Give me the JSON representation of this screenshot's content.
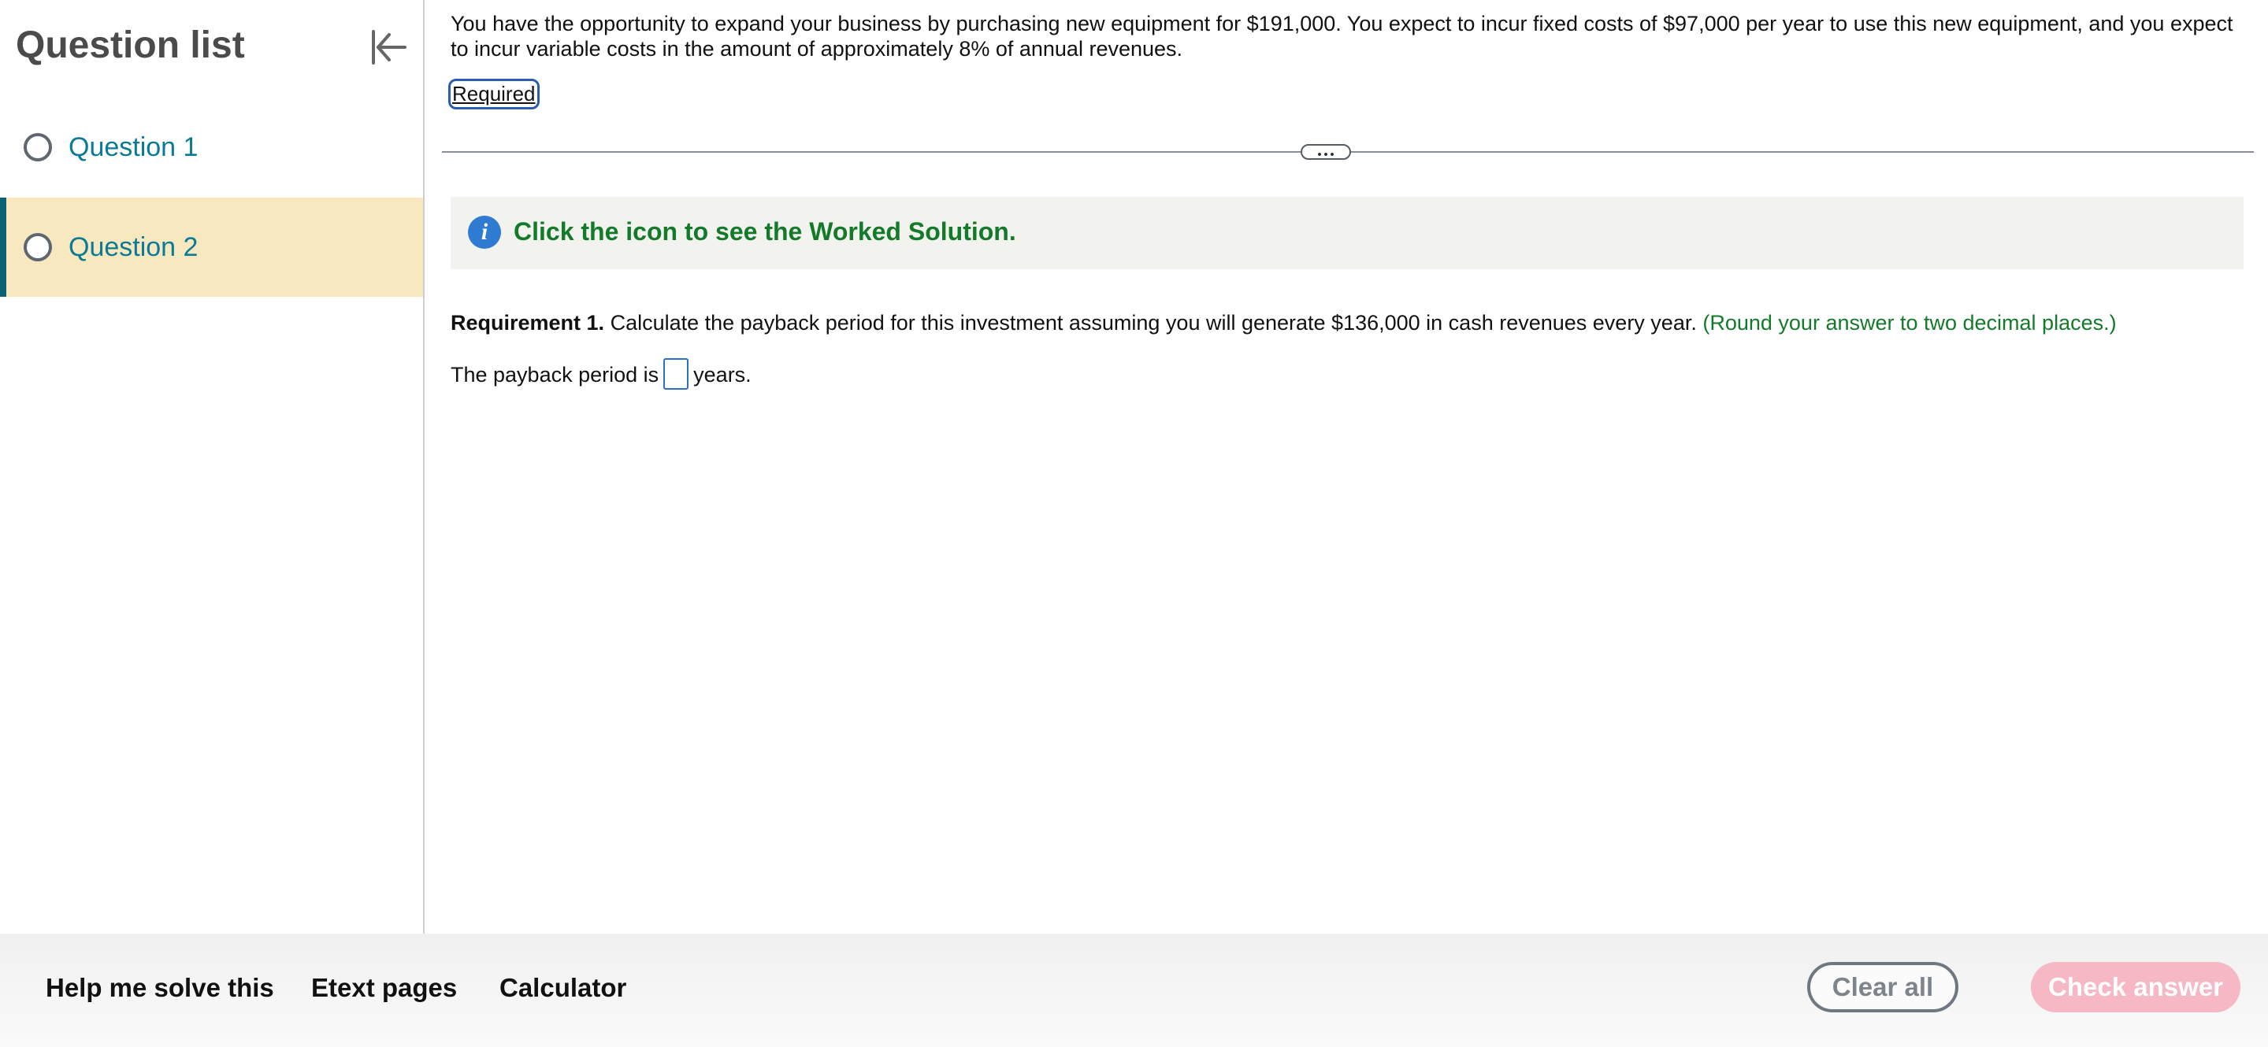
{
  "sidebar": {
    "title": "Question list",
    "items": [
      {
        "label": "Question 1",
        "active": false
      },
      {
        "label": "Question 2",
        "active": true
      }
    ]
  },
  "problem": {
    "text": "You have the opportunity to expand your business by purchasing new equipment for $191,000. You expect to incur fixed costs of $97,000 per year to use this new equipment, and you expect to incur variable costs in the amount of approximately 8% of annual revenues.",
    "required_link": "Required"
  },
  "info": {
    "text": "Click the icon to see the Worked Solution."
  },
  "requirement": {
    "label": "Requirement 1.",
    "text": " Calculate the payback period for this investment assuming you will generate $136,000 in cash revenues every year. ",
    "hint": "(Round your answer to two decimal places.)"
  },
  "answer": {
    "prefix": "The payback period is",
    "value": "",
    "suffix": "years."
  },
  "footer": {
    "help": "Help me solve this",
    "etext": "Etext pages",
    "calculator": "Calculator",
    "clear_all": "Clear all",
    "check_answer": "Check answer"
  },
  "colors": {
    "active_item_bg": "#f8e8c0",
    "active_item_bar": "#0b6275",
    "link_teal": "#0a7a96",
    "green_text": "#137a2a",
    "info_blue": "#2f7bd1",
    "check_button_disabled": "#f5b8c4"
  }
}
